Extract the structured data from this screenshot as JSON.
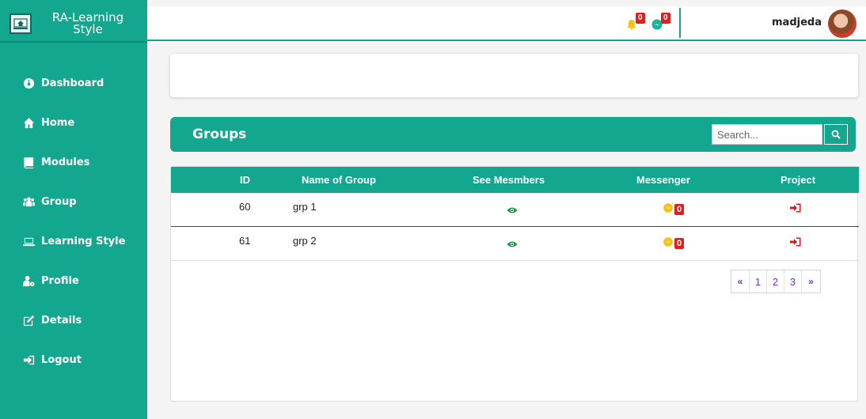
{
  "brand": {
    "title": "RA-Learning Style"
  },
  "sidebar": {
    "items": [
      {
        "label": "Dashboard",
        "icon": "dashboard-icon"
      },
      {
        "label": "Home",
        "icon": "home-icon"
      },
      {
        "label": "Modules",
        "icon": "book-icon"
      },
      {
        "label": "Group",
        "icon": "users-icon"
      },
      {
        "label": "Learning Style",
        "icon": "laptop-icon"
      },
      {
        "label": "Profile",
        "icon": "user-cog-icon"
      },
      {
        "label": "Details",
        "icon": "edit-icon"
      },
      {
        "label": "Logout",
        "icon": "logout-icon"
      }
    ]
  },
  "topbar": {
    "notifications_count": "0",
    "messages_count": "0",
    "username": "madjeda"
  },
  "groups": {
    "title": "Groups",
    "search_placeholder": "Search...",
    "columns": [
      "ID",
      "Name of Group",
      "See Mesmbers",
      "Messenger",
      "Project"
    ],
    "rows": [
      {
        "id": "60",
        "name": "grp 1",
        "messenger_count": "0"
      },
      {
        "id": "61",
        "name": "grp 2",
        "messenger_count": "0"
      }
    ],
    "pagination": [
      "«",
      "1",
      "2",
      "3",
      "»"
    ]
  },
  "colors": {
    "accent": "#14a78f",
    "badge": "#e02020",
    "link": "#7a2ad4"
  }
}
